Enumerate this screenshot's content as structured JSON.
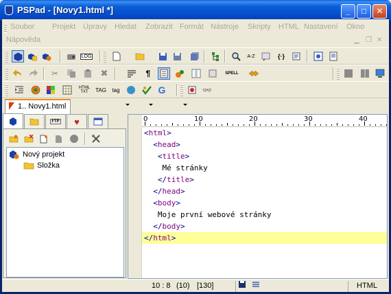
{
  "window": {
    "title": "PSPad - [Novy1.html *]",
    "buttons": {
      "minimize": "_",
      "maximize": "□",
      "close": "✕"
    }
  },
  "menu": {
    "items": [
      "Soubor",
      "Projekt",
      "Úpravy",
      "Hledat",
      "Zobrazit",
      "Formát",
      "Nástroje",
      "Skripty",
      "HTML",
      "Nastavení",
      "Okno",
      "Nápověda"
    ]
  },
  "document_tabs": [
    {
      "label": "1.. Novy1.html"
    }
  ],
  "toolbar_text": {
    "spell": "SPELL",
    "html_txt": "HTML\nTXT",
    "tag1": "TAG",
    "tag2": "tag",
    "log": "LOG",
    "ftp": "FTP",
    "pilcrow": "¶",
    "braces": "{·}",
    "atoz": "A-Z",
    "g": "G"
  },
  "project_panel": {
    "tree": [
      {
        "label": "Nový projekt",
        "icon": "project-icon",
        "level": 0
      },
      {
        "label": "Složka",
        "icon": "folder-icon",
        "level": 1
      }
    ]
  },
  "editor": {
    "ruler": [
      "0",
      "10",
      "20",
      "30",
      "40"
    ],
    "lines": [
      {
        "indent": "",
        "open": "<",
        "name": "html",
        "close": ">",
        "text": ""
      },
      {
        "indent": "  ",
        "open": "<",
        "name": "head",
        "close": ">",
        "text": ""
      },
      {
        "indent": "   ",
        "open": "<",
        "name": "title",
        "close": ">",
        "text": ""
      },
      {
        "indent": "    ",
        "open": "",
        "name": "",
        "close": "",
        "text": "Mé stránky"
      },
      {
        "indent": "   ",
        "open": "</",
        "name": "title",
        "close": ">",
        "text": ""
      },
      {
        "indent": "  ",
        "open": "</",
        "name": "head",
        "close": ">",
        "text": ""
      },
      {
        "indent": "  ",
        "open": "<",
        "name": "body",
        "close": ">",
        "text": ""
      },
      {
        "indent": "   ",
        "open": "",
        "name": "",
        "close": "",
        "text": "Moje první webové stránky"
      },
      {
        "indent": "  ",
        "open": "</",
        "name": "body",
        "close": ">",
        "text": ""
      },
      {
        "indent": "",
        "open": "</",
        "name": "html",
        "close": ">",
        "text": ""
      }
    ],
    "current_line": 9
  },
  "status": {
    "position": "10 : 8",
    "column": "(10)",
    "chars": "[130]",
    "syntax": "HTML"
  },
  "colors": {
    "tag": "#000080",
    "tagname": "#800080",
    "current_line": "#ffff99",
    "title_bar": "#0548c8"
  }
}
